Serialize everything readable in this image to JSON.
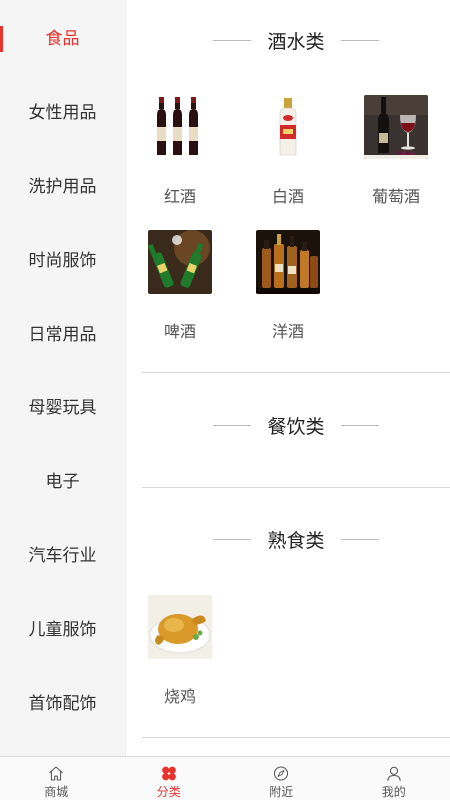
{
  "sidebar": {
    "items": [
      {
        "label": "食品",
        "active": true
      },
      {
        "label": "女性用品"
      },
      {
        "label": "洗护用品"
      },
      {
        "label": "时尚服饰"
      },
      {
        "label": "日常用品"
      },
      {
        "label": "母婴玩具"
      },
      {
        "label": "电子"
      },
      {
        "label": "汽车行业"
      },
      {
        "label": "儿童服饰"
      },
      {
        "label": "首饰配饰"
      }
    ]
  },
  "sections": [
    {
      "title": "酒水类",
      "products": [
        {
          "name": "红酒"
        },
        {
          "name": "白酒"
        },
        {
          "name": "葡萄酒"
        },
        {
          "name": "啤酒"
        },
        {
          "name": "洋酒"
        }
      ]
    },
    {
      "title": "餐饮类",
      "products": []
    },
    {
      "title": "熟食类",
      "products": [
        {
          "name": "烧鸡"
        }
      ]
    }
  ],
  "tabbar": {
    "tabs": [
      {
        "label": "商城",
        "icon": "home-icon"
      },
      {
        "label": "分类",
        "icon": "category-icon",
        "active": true
      },
      {
        "label": "附近",
        "icon": "compass-icon"
      },
      {
        "label": "我的",
        "icon": "user-icon"
      }
    ]
  },
  "colors": {
    "accent": "#e8322d",
    "sidebar_bg": "#f5f5f5",
    "text": "#333333"
  }
}
